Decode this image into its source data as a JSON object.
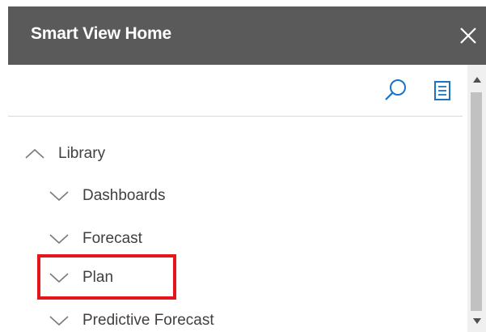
{
  "header": {
    "title": "Smart View Home"
  },
  "toolbar": {
    "icons": [
      "search-icon",
      "list-icon"
    ]
  },
  "tree": {
    "root": {
      "label": "Library",
      "expanded": true
    },
    "children": [
      {
        "label": "Dashboards",
        "expanded": false
      },
      {
        "label": "Forecast",
        "expanded": false
      },
      {
        "label": "Plan",
        "expanded": false,
        "highlighted": true
      },
      {
        "label": "Predictive Forecast",
        "expanded": false
      }
    ]
  },
  "colors": {
    "titlebar_bg": "#5a5a5a",
    "accent_blue": "#1a73c8",
    "highlight_red": "#e8141b"
  }
}
